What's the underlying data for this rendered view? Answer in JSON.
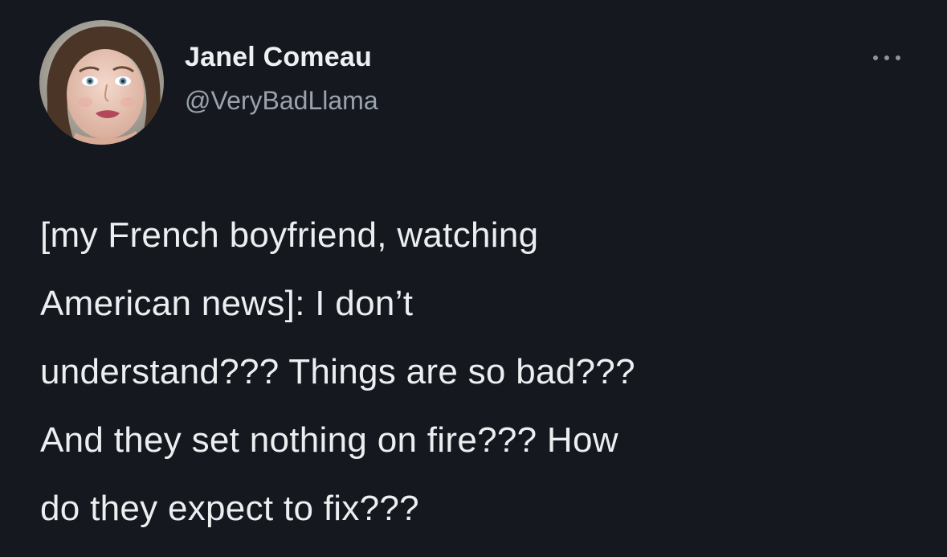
{
  "author": {
    "display_name": "Janel Comeau",
    "handle": "@VeryBadLlama",
    "avatar_icon": "profile-photo"
  },
  "menu": {
    "icon": "more-options-icon"
  },
  "tweet": {
    "lines": [
      "[my French boyfriend, watching",
      "American news]: I don’t",
      "understand??? Things are so bad???",
      "And they set nothing on fire??? How",
      "do they expect to fix???"
    ]
  },
  "colors": {
    "background": "#15181f",
    "text": "#eceef0",
    "secondary_text": "#9aa3ad"
  }
}
